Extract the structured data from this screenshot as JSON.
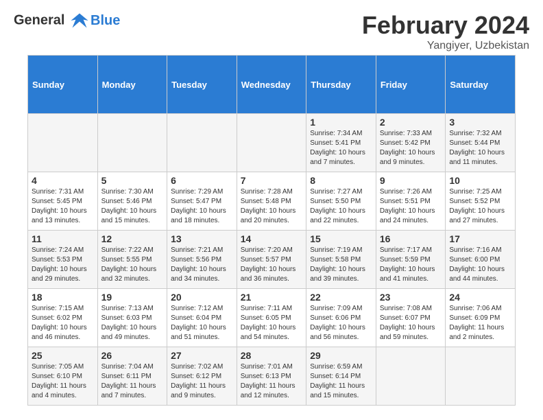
{
  "header": {
    "logo_line1": "General",
    "logo_line2": "Blue",
    "month_title": "February 2024",
    "location": "Yangiyer, Uzbekistan"
  },
  "days_of_week": [
    "Sunday",
    "Monday",
    "Tuesday",
    "Wednesday",
    "Thursday",
    "Friday",
    "Saturday"
  ],
  "weeks": [
    [
      {
        "num": "",
        "info": ""
      },
      {
        "num": "",
        "info": ""
      },
      {
        "num": "",
        "info": ""
      },
      {
        "num": "",
        "info": ""
      },
      {
        "num": "1",
        "info": "Sunrise: 7:34 AM\nSunset: 5:41 PM\nDaylight: 10 hours\nand 7 minutes."
      },
      {
        "num": "2",
        "info": "Sunrise: 7:33 AM\nSunset: 5:42 PM\nDaylight: 10 hours\nand 9 minutes."
      },
      {
        "num": "3",
        "info": "Sunrise: 7:32 AM\nSunset: 5:44 PM\nDaylight: 10 hours\nand 11 minutes."
      }
    ],
    [
      {
        "num": "4",
        "info": "Sunrise: 7:31 AM\nSunset: 5:45 PM\nDaylight: 10 hours\nand 13 minutes."
      },
      {
        "num": "5",
        "info": "Sunrise: 7:30 AM\nSunset: 5:46 PM\nDaylight: 10 hours\nand 15 minutes."
      },
      {
        "num": "6",
        "info": "Sunrise: 7:29 AM\nSunset: 5:47 PM\nDaylight: 10 hours\nand 18 minutes."
      },
      {
        "num": "7",
        "info": "Sunrise: 7:28 AM\nSunset: 5:48 PM\nDaylight: 10 hours\nand 20 minutes."
      },
      {
        "num": "8",
        "info": "Sunrise: 7:27 AM\nSunset: 5:50 PM\nDaylight: 10 hours\nand 22 minutes."
      },
      {
        "num": "9",
        "info": "Sunrise: 7:26 AM\nSunset: 5:51 PM\nDaylight: 10 hours\nand 24 minutes."
      },
      {
        "num": "10",
        "info": "Sunrise: 7:25 AM\nSunset: 5:52 PM\nDaylight: 10 hours\nand 27 minutes."
      }
    ],
    [
      {
        "num": "11",
        "info": "Sunrise: 7:24 AM\nSunset: 5:53 PM\nDaylight: 10 hours\nand 29 minutes."
      },
      {
        "num": "12",
        "info": "Sunrise: 7:22 AM\nSunset: 5:55 PM\nDaylight: 10 hours\nand 32 minutes."
      },
      {
        "num": "13",
        "info": "Sunrise: 7:21 AM\nSunset: 5:56 PM\nDaylight: 10 hours\nand 34 minutes."
      },
      {
        "num": "14",
        "info": "Sunrise: 7:20 AM\nSunset: 5:57 PM\nDaylight: 10 hours\nand 36 minutes."
      },
      {
        "num": "15",
        "info": "Sunrise: 7:19 AM\nSunset: 5:58 PM\nDaylight: 10 hours\nand 39 minutes."
      },
      {
        "num": "16",
        "info": "Sunrise: 7:17 AM\nSunset: 5:59 PM\nDaylight: 10 hours\nand 41 minutes."
      },
      {
        "num": "17",
        "info": "Sunrise: 7:16 AM\nSunset: 6:00 PM\nDaylight: 10 hours\nand 44 minutes."
      }
    ],
    [
      {
        "num": "18",
        "info": "Sunrise: 7:15 AM\nSunset: 6:02 PM\nDaylight: 10 hours\nand 46 minutes."
      },
      {
        "num": "19",
        "info": "Sunrise: 7:13 AM\nSunset: 6:03 PM\nDaylight: 10 hours\nand 49 minutes."
      },
      {
        "num": "20",
        "info": "Sunrise: 7:12 AM\nSunset: 6:04 PM\nDaylight: 10 hours\nand 51 minutes."
      },
      {
        "num": "21",
        "info": "Sunrise: 7:11 AM\nSunset: 6:05 PM\nDaylight: 10 hours\nand 54 minutes."
      },
      {
        "num": "22",
        "info": "Sunrise: 7:09 AM\nSunset: 6:06 PM\nDaylight: 10 hours\nand 56 minutes."
      },
      {
        "num": "23",
        "info": "Sunrise: 7:08 AM\nSunset: 6:07 PM\nDaylight: 10 hours\nand 59 minutes."
      },
      {
        "num": "24",
        "info": "Sunrise: 7:06 AM\nSunset: 6:09 PM\nDaylight: 11 hours\nand 2 minutes."
      }
    ],
    [
      {
        "num": "25",
        "info": "Sunrise: 7:05 AM\nSunset: 6:10 PM\nDaylight: 11 hours\nand 4 minutes."
      },
      {
        "num": "26",
        "info": "Sunrise: 7:04 AM\nSunset: 6:11 PM\nDaylight: 11 hours\nand 7 minutes."
      },
      {
        "num": "27",
        "info": "Sunrise: 7:02 AM\nSunset: 6:12 PM\nDaylight: 11 hours\nand 9 minutes."
      },
      {
        "num": "28",
        "info": "Sunrise: 7:01 AM\nSunset: 6:13 PM\nDaylight: 11 hours\nand 12 minutes."
      },
      {
        "num": "29",
        "info": "Sunrise: 6:59 AM\nSunset: 6:14 PM\nDaylight: 11 hours\nand 15 minutes."
      },
      {
        "num": "",
        "info": ""
      },
      {
        "num": "",
        "info": ""
      }
    ]
  ]
}
